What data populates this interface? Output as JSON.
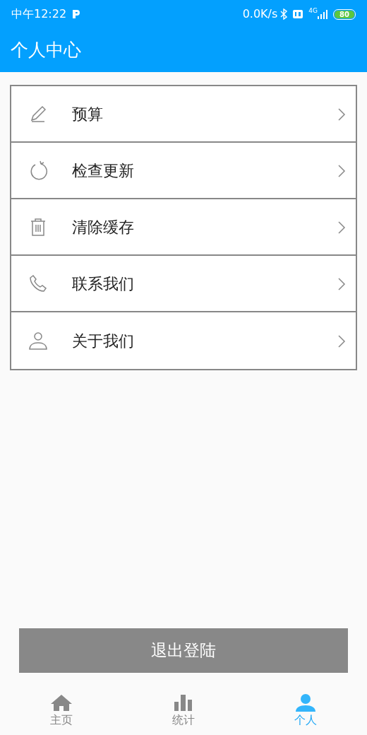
{
  "status_bar": {
    "time": "中午12:22",
    "speed": "0.0K/s",
    "network": "4G",
    "battery": "80"
  },
  "title": "个人中心",
  "menu": [
    {
      "kind": "pencil",
      "label": "预算"
    },
    {
      "kind": "refresh",
      "label": "检查更新"
    },
    {
      "kind": "trash",
      "label": "清除缓存"
    },
    {
      "kind": "phone",
      "label": "联系我们"
    },
    {
      "kind": "person",
      "label": "关于我们"
    }
  ],
  "logout_button": "退出登陆",
  "tabs": [
    {
      "kind": "home",
      "label": "主页",
      "selected": false
    },
    {
      "kind": "chart",
      "label": "统计",
      "selected": false
    },
    {
      "kind": "person",
      "label": "个人",
      "selected": true
    }
  ]
}
